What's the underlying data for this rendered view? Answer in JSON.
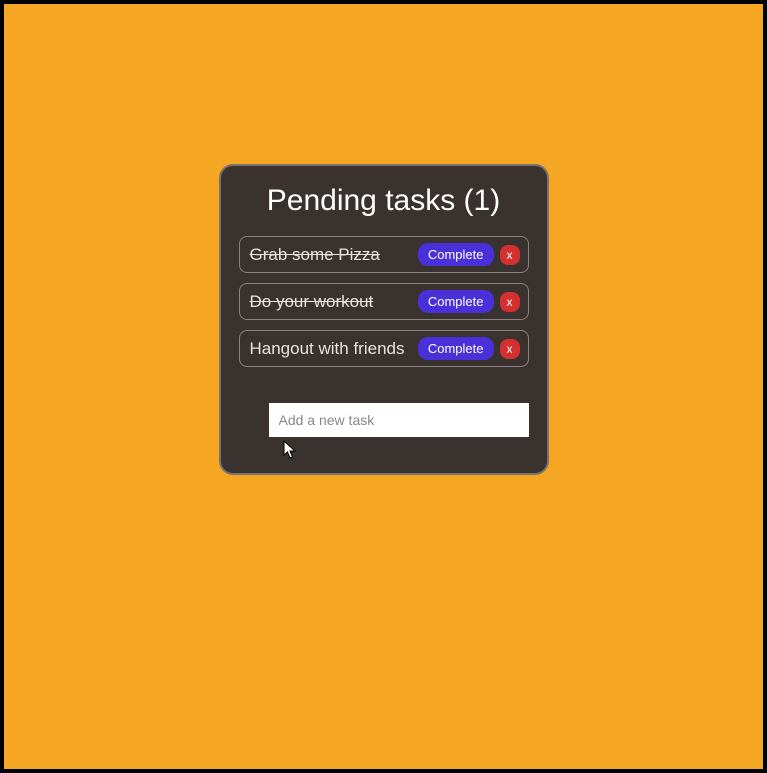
{
  "header": {
    "title_prefix": "Pending tasks",
    "pending_count": 1
  },
  "tasks": [
    {
      "label": "Grab some Pizza",
      "completed": true,
      "complete_btn": "Complete",
      "delete_btn": "x"
    },
    {
      "label": "Do your workout",
      "completed": true,
      "complete_btn": "Complete",
      "delete_btn": "x"
    },
    {
      "label": "Hangout with friends",
      "completed": false,
      "complete_btn": "Complete",
      "delete_btn": "x"
    }
  ],
  "input": {
    "placeholder": "Add a new task",
    "value": ""
  },
  "computed": {
    "title_full": "Pending tasks (1)"
  }
}
